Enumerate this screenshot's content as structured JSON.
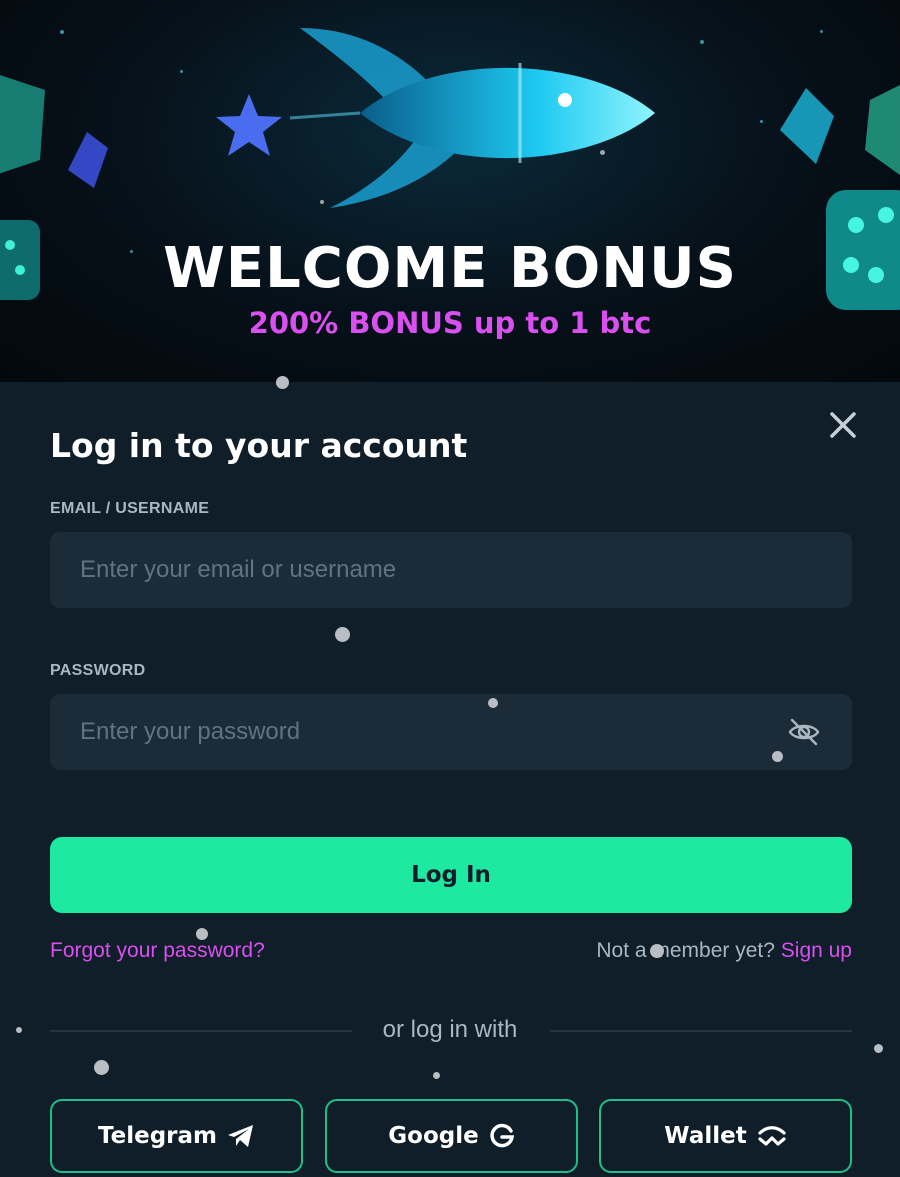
{
  "banner": {
    "title": "WELCOME BONUS",
    "subtitle": "200% BONUS up to 1 btc"
  },
  "login": {
    "heading": "Log in to your account",
    "email_label": "EMAIL / USERNAME",
    "email_placeholder": "Enter your email or username",
    "password_label": "PASSWORD",
    "password_placeholder": "Enter your password",
    "submit_label": "Log In",
    "forgot_label": "Forgot your password?",
    "member_prompt": "Not a member yet?",
    "signup_label": "Sign up",
    "divider_text": "or log in with"
  },
  "social": [
    {
      "label": "Telegram",
      "icon": "telegram-icon"
    },
    {
      "label": "Google",
      "icon": "google-icon"
    },
    {
      "label": "Wallet",
      "icon": "walletconnect-icon"
    }
  ],
  "colors": {
    "accent_green": "#1de9a0",
    "accent_pink": "#d94ff0",
    "panel_bg": "#0f1e28",
    "input_bg": "#1b2c38"
  }
}
